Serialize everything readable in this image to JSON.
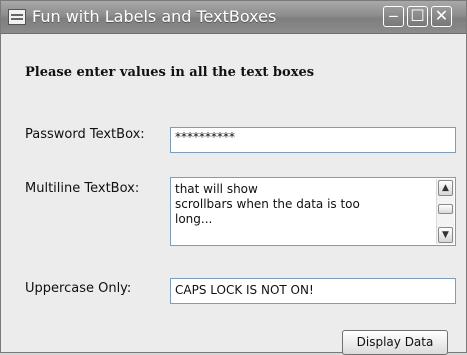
{
  "window": {
    "title": "Fun with Labels and TextBoxes",
    "controls": {
      "minimize": "‒",
      "maximize": "☐",
      "close": "✕"
    }
  },
  "form": {
    "heading": "Please enter values in all the text boxes",
    "password_label": "Password TextBox:",
    "password_value": "**********",
    "multiline_label": "Multiline TextBox:",
    "multiline_lines": [
      "that will show",
      "scrollbars when the data is too",
      "long..."
    ],
    "uppercase_label": "Uppercase Only:",
    "uppercase_value": "CAPS LOCK IS NOT ON!",
    "button_label": "Display Data"
  },
  "icons": [
    "app-icon",
    "minimize-icon",
    "maximize-icon",
    "close-icon",
    "scroll-up-icon",
    "scroll-down-icon"
  ]
}
